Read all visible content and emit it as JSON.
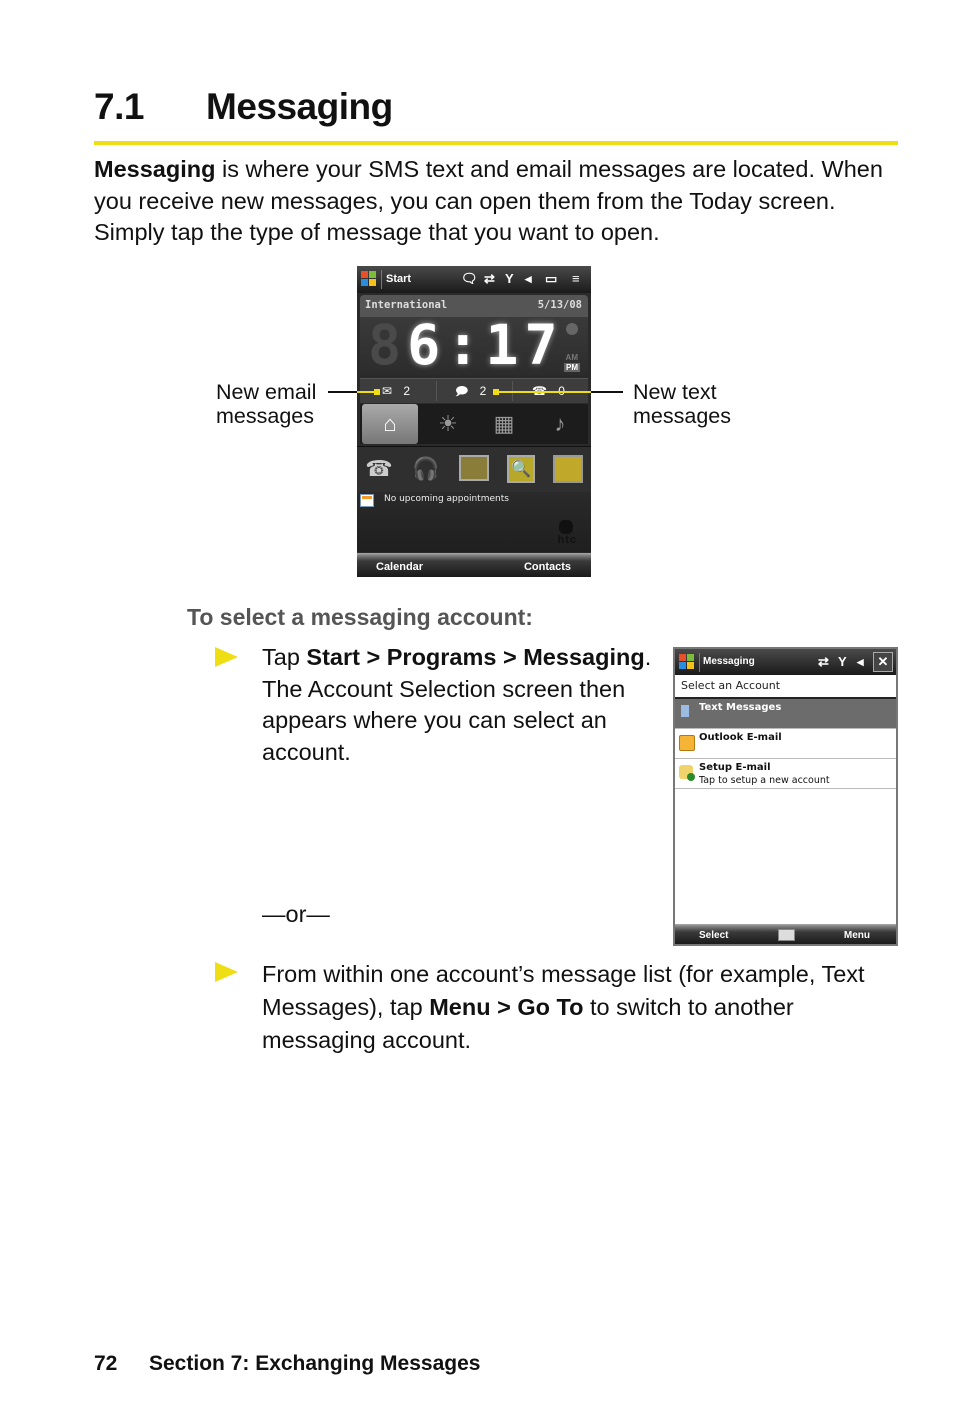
{
  "section": {
    "number": "7.1",
    "title": "Messaging"
  },
  "intro": {
    "bold_lead": "Messaging",
    "text": " is where your SMS text and email messages are located. When you receive new messages, you can open them from the Today screen. Simply tap the type of message that you want to open."
  },
  "today_screen": {
    "titlebar": {
      "start_label": "Start",
      "status_icons": [
        "notification-bubble-icon",
        "sync-arrows-icon",
        "signal-icon",
        "volume-icon",
        "battery-icon",
        "menu-icon"
      ]
    },
    "clock": {
      "city": "International",
      "date": "5/13/08",
      "time": "6:17",
      "am_label": "AM",
      "pm_label": "PM"
    },
    "notifications": {
      "email_count": "2",
      "text_count": "2",
      "missed_calls_count": "0"
    },
    "tabs": [
      "home-icon",
      "weather-sun-icon",
      "apps-grid-icon",
      "music-phone-icon"
    ],
    "apps": [
      "phone-icon",
      "headphones-icon",
      "people-icon",
      "search-icon",
      "sprint-tv-icon"
    ],
    "appointment_text": "No upcoming appointments",
    "brand": "htc",
    "softkeys": {
      "left": "Calendar",
      "right": "Contacts"
    }
  },
  "callouts": {
    "left": "New email messages",
    "left_line1": "New email",
    "left_line2": "messages",
    "right_line1": "New text",
    "right_line2": "messages"
  },
  "procedure": {
    "heading": "To select a messaging account:",
    "step1": {
      "prefix": "Tap ",
      "path": "Start > Programs > Messaging",
      "suffix": ". The Account Selection screen then appears where you can select an account."
    },
    "or_text": "—or—",
    "step2": {
      "prefix": "From within one account’s message list (for example, Text Messages), tap ",
      "path": "Menu > Go To",
      "suffix": " to switch to another messaging account."
    }
  },
  "messaging_screen": {
    "title": "Messaging",
    "close_label": "✕",
    "header": "Select an Account",
    "accounts": [
      {
        "name": "Text Messages",
        "sub": "",
        "selected": true
      },
      {
        "name": "Outlook E-mail",
        "sub": "",
        "selected": false
      },
      {
        "name": "Setup E-mail",
        "sub": "Tap to setup a new account",
        "selected": false
      }
    ],
    "softkeys": {
      "left": "Select",
      "right": "Menu"
    }
  },
  "footer": {
    "page_number": "72",
    "section_label": "Section 7: Exchanging Messages"
  },
  "colors": {
    "accent_yellow": "#f0de14",
    "subheading_gray": "#555555"
  }
}
